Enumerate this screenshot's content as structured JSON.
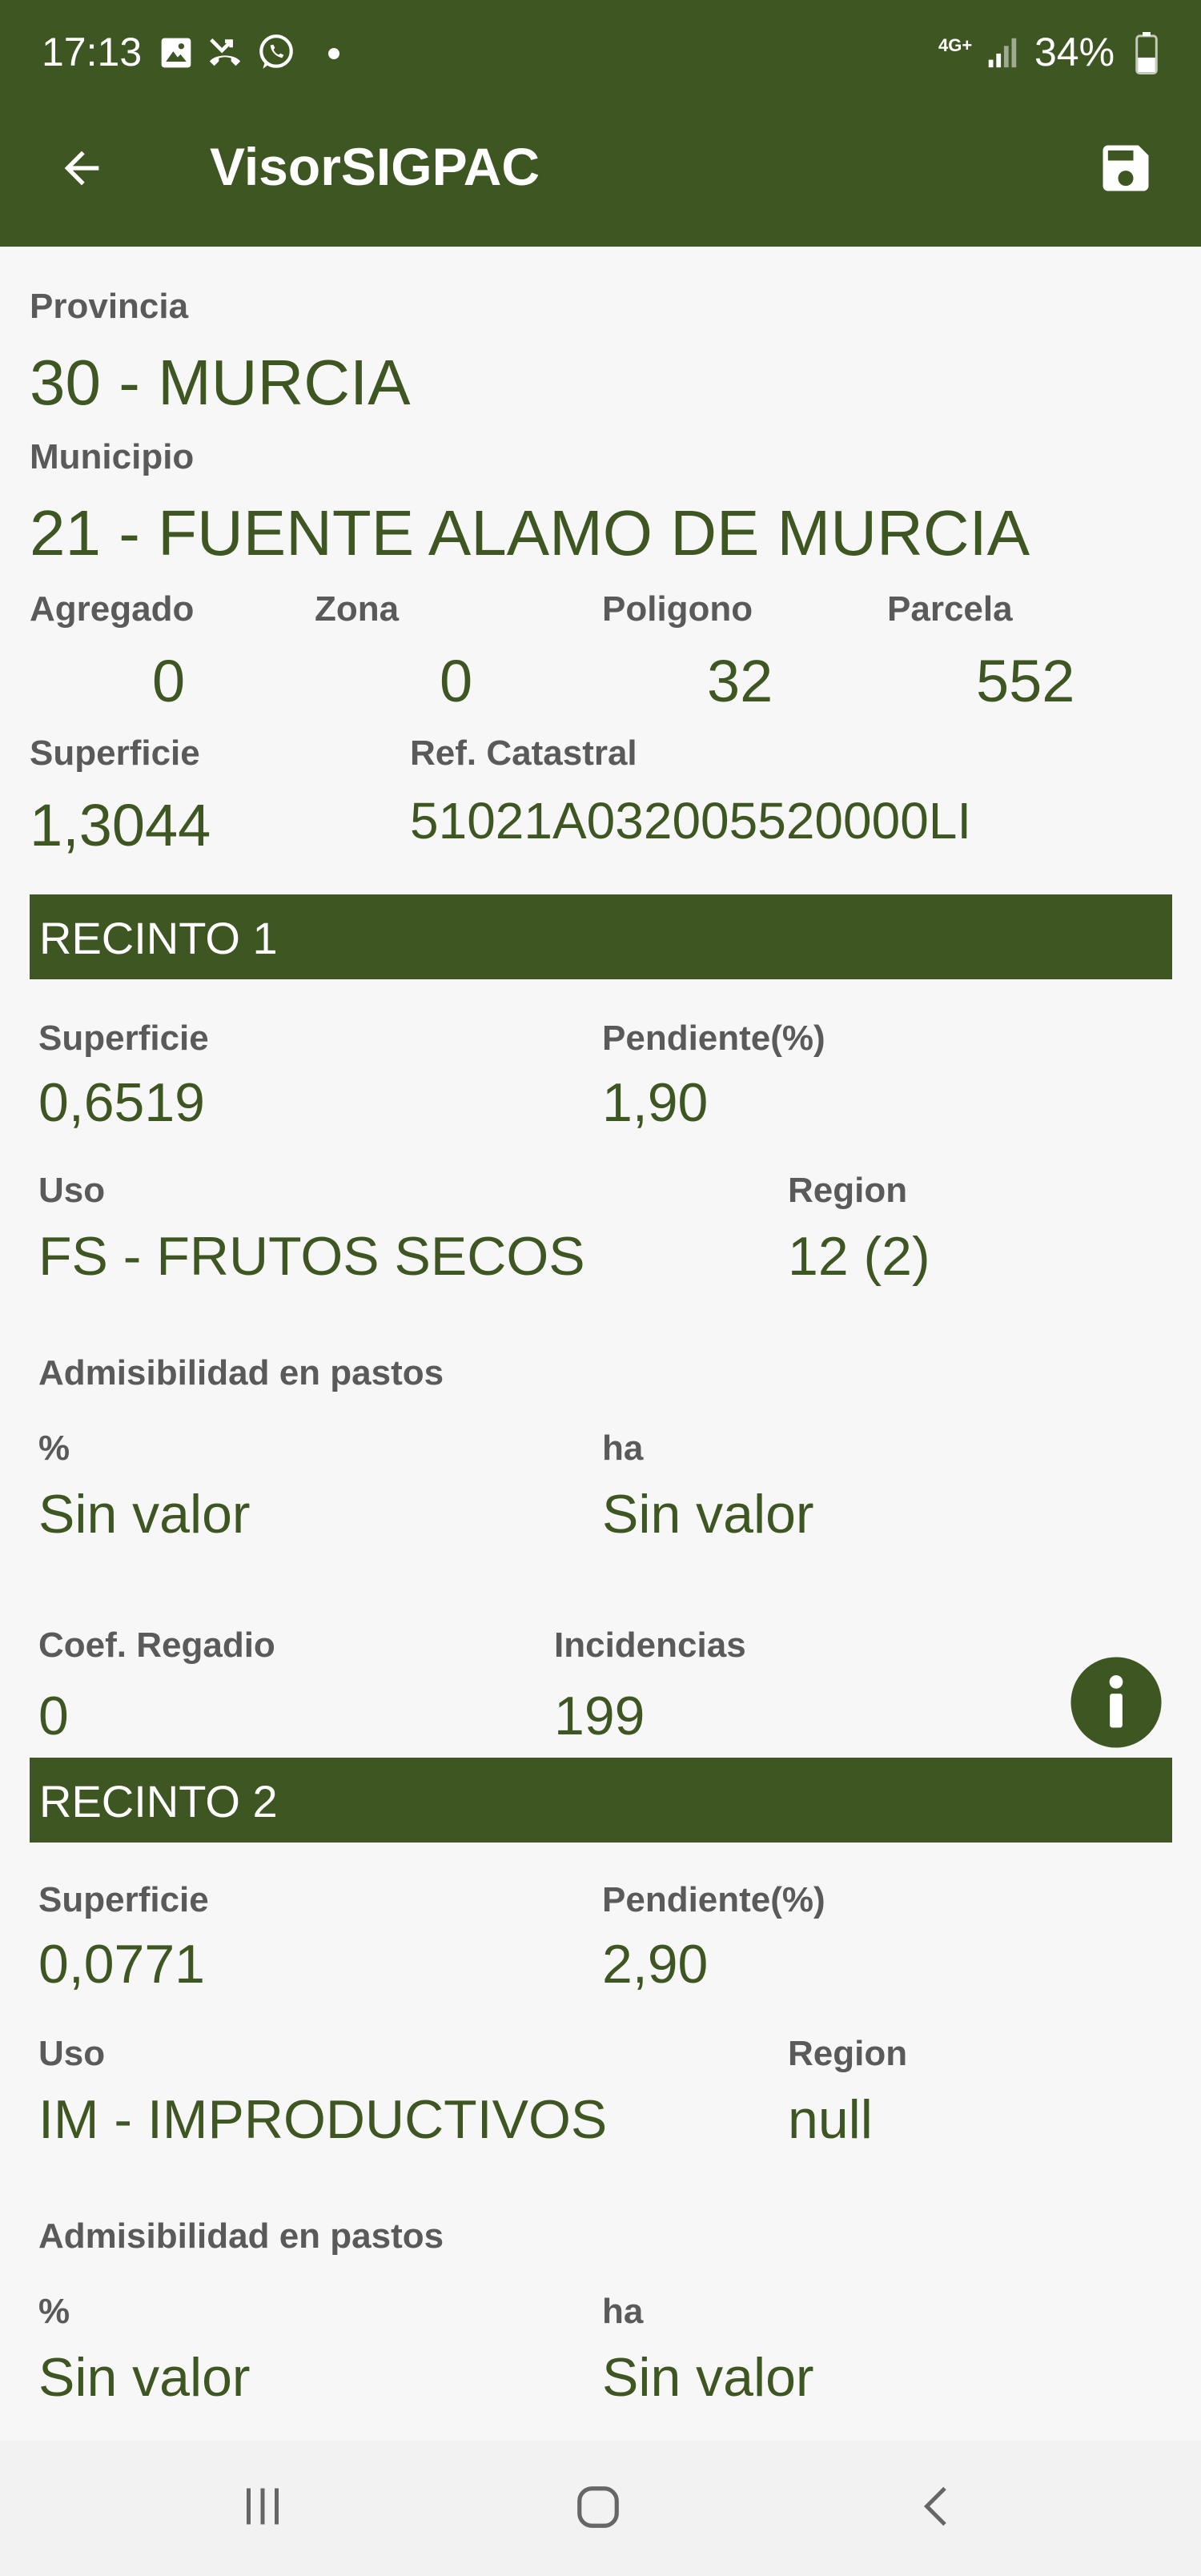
{
  "status_bar": {
    "time": "17:13",
    "network": "4G+",
    "battery": "34%",
    "left_icons": [
      "gallery-icon",
      "missed-call-icon",
      "whatsapp-icon",
      "dot-icon"
    ],
    "right_icons": [
      "signal-icon",
      "battery-icon"
    ]
  },
  "app_bar": {
    "title": "VisorSIGPAC",
    "back_icon": "arrow-left-icon",
    "save_icon": "save-icon"
  },
  "parcel": {
    "provincia_label": "Provincia",
    "provincia_value": "30 - MURCIA",
    "municipio_label": "Municipio",
    "municipio_value": "21 - FUENTE ALAMO DE MURCIA",
    "agregado_label": "Agregado",
    "agregado_value": "0",
    "zona_label": "Zona",
    "zona_value": "0",
    "poligono_label": "Poligono",
    "poligono_value": "32",
    "parcela_label": "Parcela",
    "parcela_value": "552",
    "superficie_label": "Superficie",
    "superficie_value": "1,3044",
    "ref_label": "Ref. Catastral",
    "ref_value": "51021A032005520000LI"
  },
  "recintos": [
    {
      "title": "RECINTO 1",
      "superficie_label": "Superficie",
      "superficie_value": "0,6519",
      "pendiente_label": "Pendiente(%)",
      "pendiente_value": "1,90",
      "uso_label": "Uso",
      "uso_value": "FS - FRUTOS SECOS",
      "region_label": "Region",
      "region_value": "12 (2)",
      "admis_label": "Admisibilidad en pastos",
      "pct_label": "%",
      "pct_value": "Sin valor",
      "ha_label": "ha",
      "ha_value": "Sin valor",
      "coef_label": "Coef. Regadio",
      "coef_value": "0",
      "incid_label": "Incidencias",
      "incid_value": "199"
    },
    {
      "title": "RECINTO 2",
      "superficie_label": "Superficie",
      "superficie_value": "0,0771",
      "pendiente_label": "Pendiente(%)",
      "pendiente_value": "2,90",
      "uso_label": "Uso",
      "uso_value": "IM - IMPRODUCTIVOS",
      "region_label": "Region",
      "region_value": "null",
      "admis_label": "Admisibilidad en pastos",
      "pct_label": "%",
      "pct_value": "Sin valor",
      "ha_label": "ha",
      "ha_value": "Sin valor"
    }
  ],
  "nav_bar": {
    "icons": [
      "recent-apps-icon",
      "home-icon",
      "back-icon"
    ]
  },
  "colors": {
    "primary": "#3e5621",
    "background": "#f7f7f7",
    "label_gray": "#5a5a5a"
  }
}
